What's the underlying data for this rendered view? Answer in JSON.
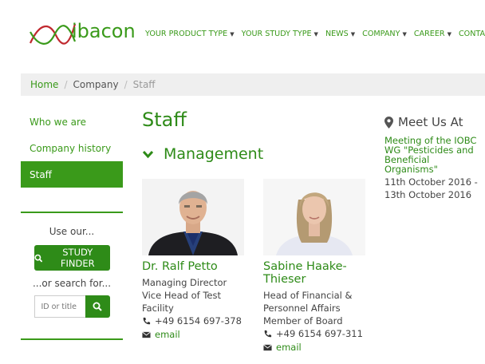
{
  "brand": {
    "name": "ibacon",
    "color": "#3a9a1a"
  },
  "nav": [
    {
      "label": "YOUR PRODUCT TYPE"
    },
    {
      "label": "YOUR STUDY TYPE"
    },
    {
      "label": "NEWS"
    },
    {
      "label": "COMPANY"
    },
    {
      "label": "CAREER"
    },
    {
      "label": "CONTACT"
    }
  ],
  "breadcrumb": {
    "home": "Home",
    "company": "Company",
    "current": "Staff",
    "separator": "/"
  },
  "sidebar": {
    "items": [
      {
        "label": "Who we are"
      },
      {
        "label": "Company history"
      },
      {
        "label": "Staff"
      }
    ],
    "finder_label": "Use our...",
    "finder_button": "STUDY FINDER",
    "search_label": "...or search for...",
    "search_placeholder": "ID or title"
  },
  "main": {
    "title": "Staff",
    "section": "Management",
    "staff": [
      {
        "name": "Dr. Ralf Petto",
        "roles": [
          "Managing Director",
          "Vice Head of Test",
          "Facility"
        ],
        "phone": "+49 6154 697-378",
        "email": "email"
      },
      {
        "name": "Sabine Haake-Thieser",
        "name_lines": [
          "Sabine Haake-",
          "Thieser"
        ],
        "roles": [
          "Head of Financial &",
          "Personnel Affairs",
          "Member of Board"
        ],
        "phone": "+49 6154 697-311",
        "email": "email"
      }
    ]
  },
  "meet": {
    "title": "Meet Us At",
    "event_lines": [
      "Meeting of the IOBC",
      "WG \"Pesticides and",
      "Beneficial Organisms\""
    ],
    "date_lines": [
      "11th October 2016 -",
      "13th October 2016"
    ]
  }
}
